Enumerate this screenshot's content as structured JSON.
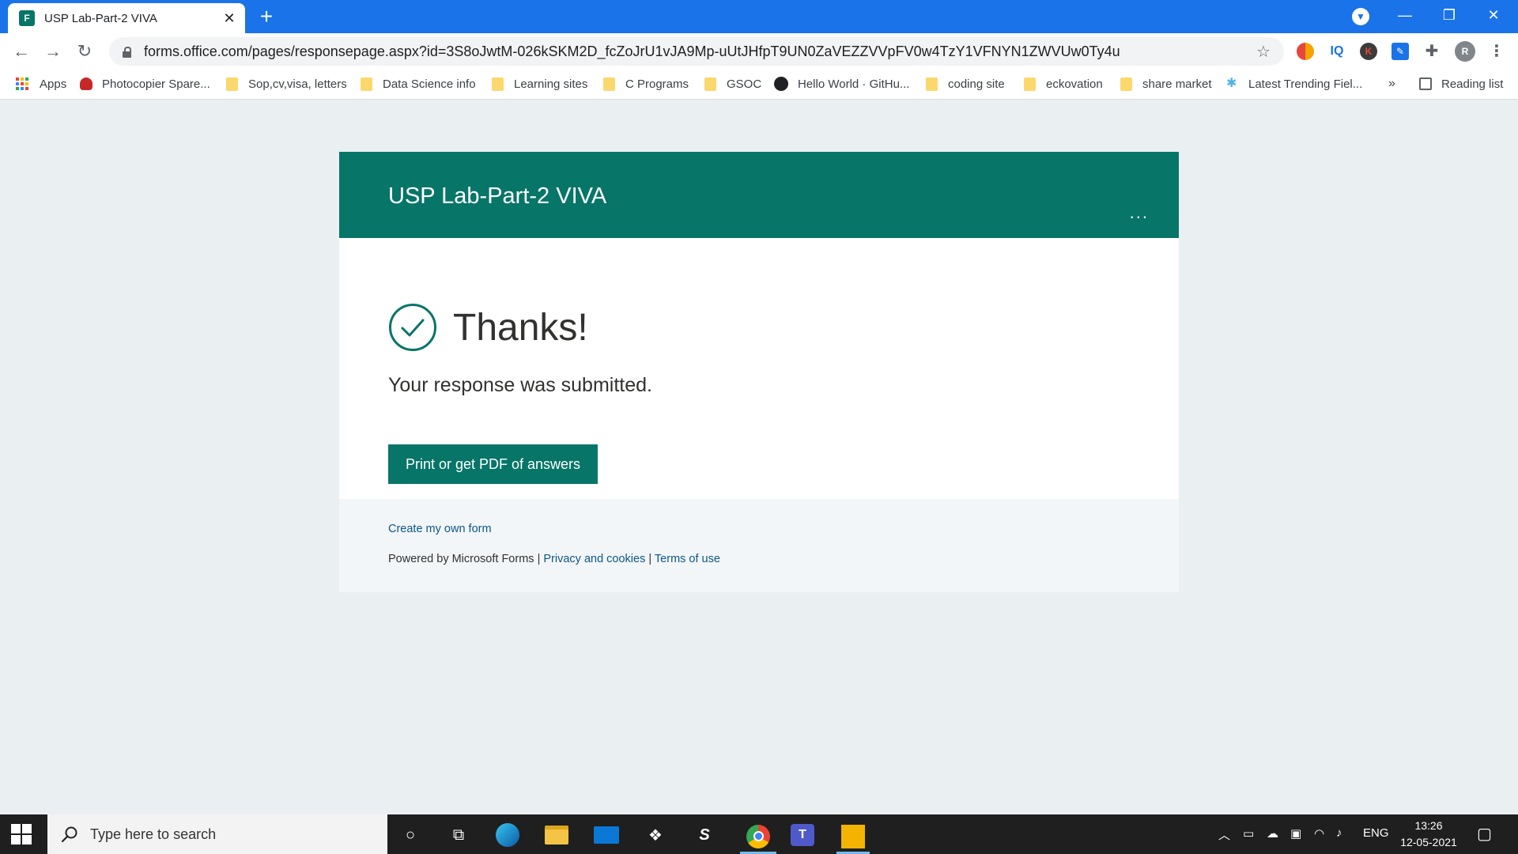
{
  "browser": {
    "tab_title": "USP Lab-Part-2 VIVA",
    "tab_favicon": "forms-favicon-icon",
    "url": "forms.office.com/pages/responsepage.aspx?id=3S8oJwtM-026kSKM2D_fcZoJrU1vJA9Mp-uUtJHfpT9UN0ZaVEZZVVpFV0w4TzY1VFNYN1ZWVUw0Ty4u",
    "profile_initial": "R",
    "extension_iq": "IQ",
    "extension_k": "K",
    "accent": "#1a73e8"
  },
  "bookmarks": {
    "apps": "Apps",
    "items": [
      {
        "label": "Photocopier Spare...",
        "icon": "photocopier-icon"
      },
      {
        "label": "Sop,cv,visa, letters",
        "icon": "folder-icon"
      },
      {
        "label": "Data Science info",
        "icon": "folder-icon"
      },
      {
        "label": "Learning sites",
        "icon": "folder-icon"
      },
      {
        "label": "C Programs",
        "icon": "folder-icon"
      },
      {
        "label": "GSOC",
        "icon": "folder-icon"
      },
      {
        "label": "Hello World · GitHu...",
        "icon": "github-icon"
      },
      {
        "label": "coding site",
        "icon": "folder-icon"
      },
      {
        "label": "eckovation",
        "icon": "folder-icon"
      },
      {
        "label": "share market",
        "icon": "folder-icon"
      },
      {
        "label": "Latest Trending Fiel...",
        "icon": "sparkle-icon"
      }
    ],
    "overflow": "»",
    "reading_list": "Reading list"
  },
  "form": {
    "title": "USP Lab-Part-2 VIVA",
    "more": "...",
    "thanks": "Thanks!",
    "submitted": "Your response was submitted.",
    "print_button": "Print or get PDF of answers",
    "create_link": "Create my own form",
    "powered_by": "Powered by Microsoft Forms",
    "separator": "|",
    "privacy_link": "Privacy and cookies",
    "terms_link": "Terms of use",
    "accent": "#077568"
  },
  "taskbar": {
    "search_placeholder": "Type here to search",
    "language": "ENG",
    "time": "13:26",
    "date": "12-05-2021",
    "apps": [
      "cortana-icon",
      "task-view-icon",
      "edge-icon",
      "file-explorer-icon",
      "mail-icon",
      "dropbox-icon",
      "sublime-icon",
      "chrome-icon",
      "teams-icon",
      "app-icon"
    ]
  }
}
